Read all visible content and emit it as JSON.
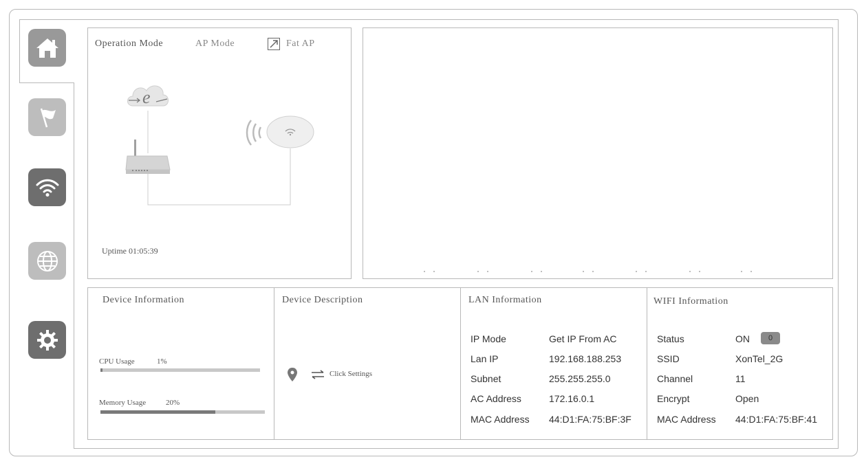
{
  "nav": {
    "items": [
      {
        "icon": "home-icon"
      },
      {
        "icon": "flag-icon"
      },
      {
        "icon": "wifi-icon"
      },
      {
        "icon": "globe-icon"
      },
      {
        "icon": "gear-icon"
      }
    ]
  },
  "operation": {
    "title": "Operation Mode",
    "mode": "AP Mode",
    "fat_ap": "Fat AP",
    "uptime": "Uptime 01:05:39"
  },
  "device_info": {
    "title": "Device Information",
    "cpu_label": "CPU Usage",
    "cpu_value": "1%",
    "cpu_fraction": 0.01,
    "mem_label": "Memory Usage",
    "mem_value": "20%",
    "mem_fraction": 0.7
  },
  "device_desc": {
    "title": "Device Description",
    "action": "Click Settings"
  },
  "lan": {
    "title": "LAN Information",
    "rows": [
      {
        "key": "IP Mode",
        "value": "Get IP From AC"
      },
      {
        "key": "Lan IP",
        "value": "192.168.188.253"
      },
      {
        "key": "Subnet",
        "value": "255.255.255.0"
      },
      {
        "key": "AC Address",
        "value": "172.16.0.1"
      },
      {
        "key": "MAC Address",
        "value": "44:D1:FA:75:BF:3F"
      }
    ]
  },
  "wifi": {
    "title": "WIFI Information",
    "status_key": "Status",
    "status_value": "ON",
    "status_toggle": "0",
    "rows": [
      {
        "key": "SSID",
        "value": "XonTel_2G"
      },
      {
        "key": "Channel",
        "value": "11"
      },
      {
        "key": "Encrypt",
        "value": "Open"
      },
      {
        "key": "MAC Address",
        "value": "44:D1:FA:75:BF:41"
      }
    ]
  }
}
